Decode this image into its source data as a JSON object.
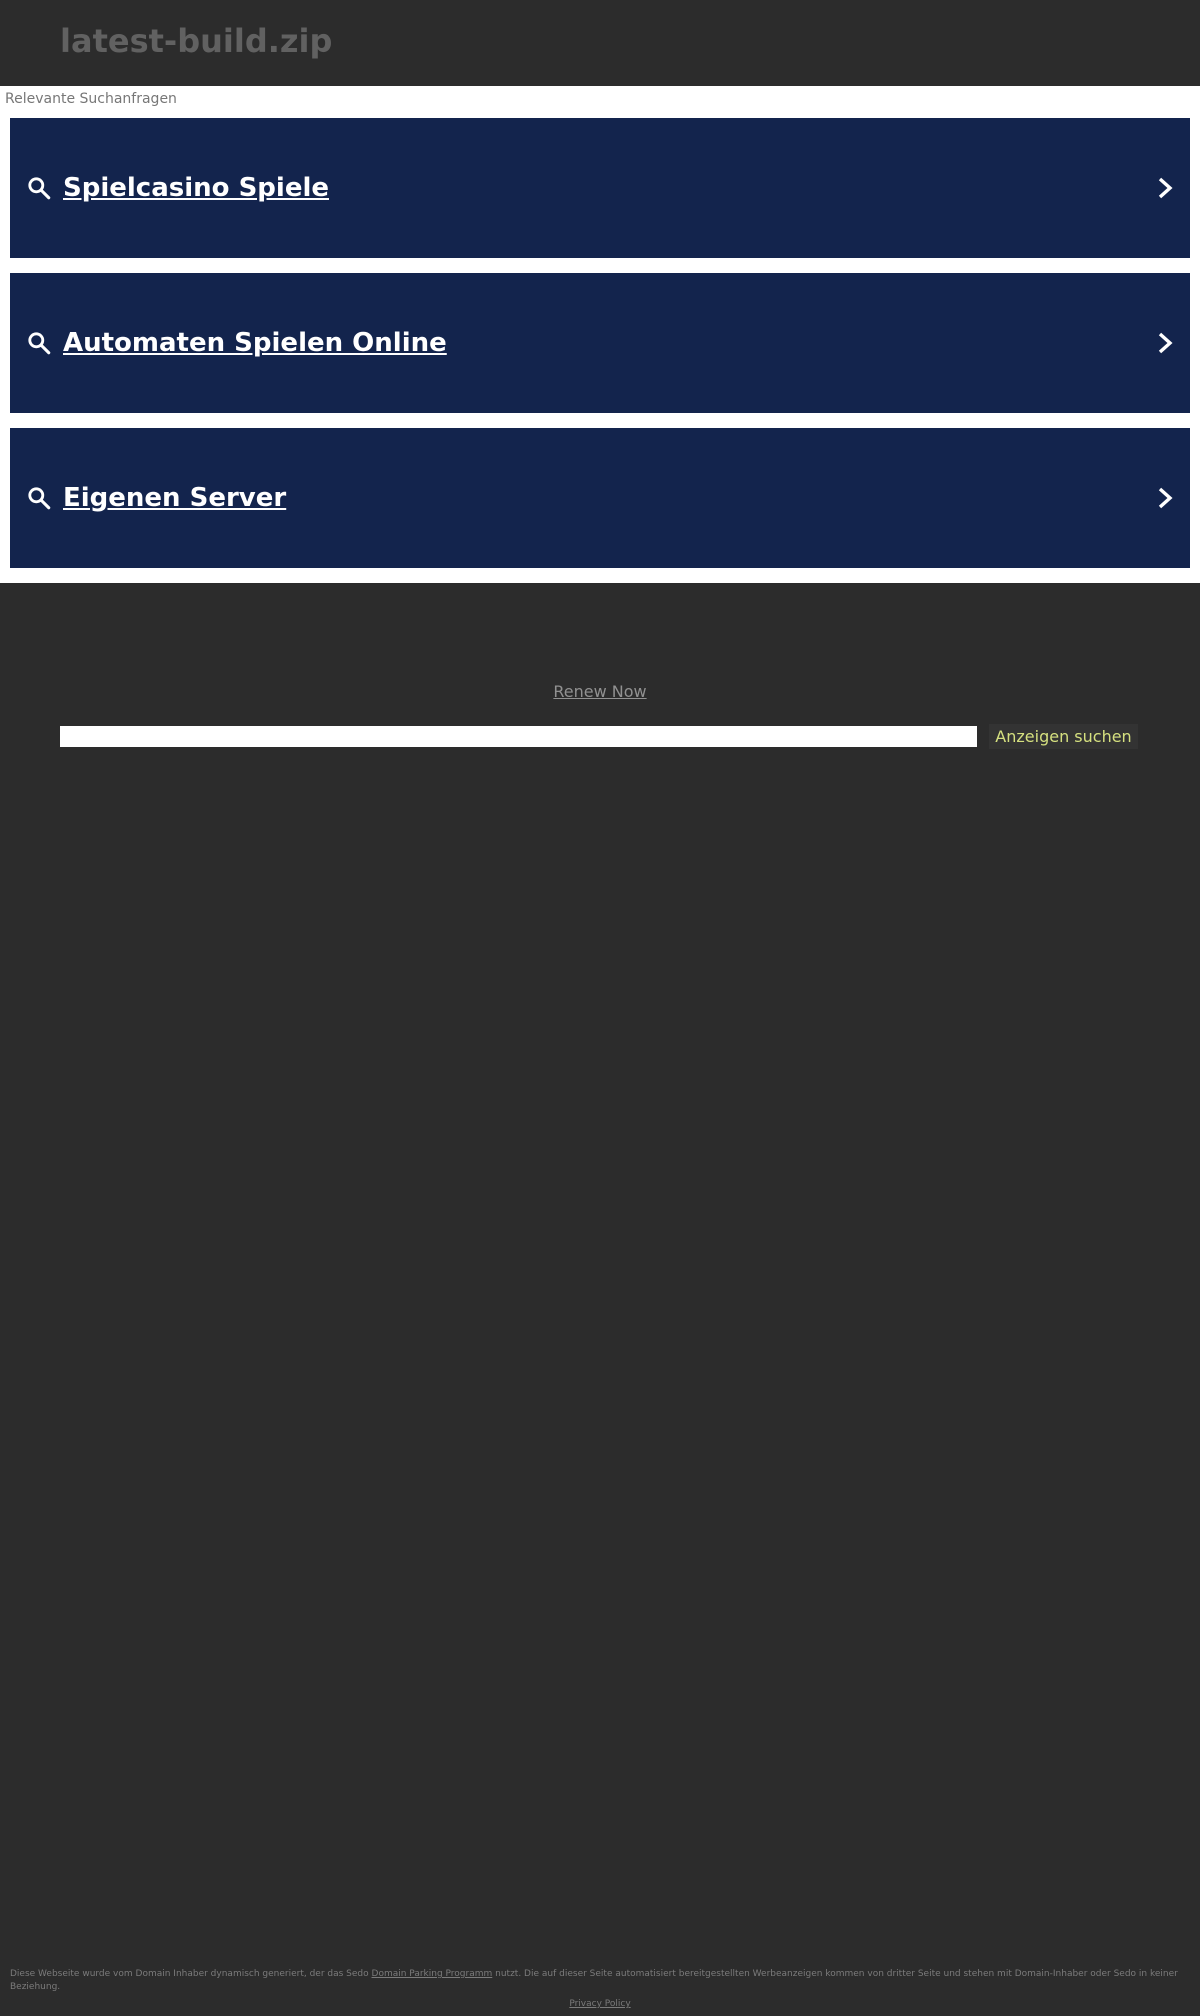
{
  "header": {
    "domain": "latest-build.zip"
  },
  "related_searches": {
    "heading": "Relevante Suchanfragen",
    "items": [
      {
        "label": "Spielcasino Spiele"
      },
      {
        "label": "Automaten Spielen Online"
      },
      {
        "label": "Eigenen Server"
      }
    ]
  },
  "renew": {
    "label": "Renew Now"
  },
  "search": {
    "value": "",
    "button_label": "Anzeigen suchen"
  },
  "footer": {
    "text_before": "Diese Webseite wurde vom Domain Inhaber dynamisch generiert, der das Sedo ",
    "link_label": "Domain Parking Programm",
    "text_after": " nutzt. Die auf dieser Seite automatisiert bereitgestellten Werbeanzeigen kommen von dritter Seite und stehen mit Domain-Inhaber oder Sedo in keiner Beziehung.",
    "privacy_label": "Privacy Policy"
  },
  "colors": {
    "page_background": "#2c2c2c",
    "result_background": "#13244d",
    "result_text": "#ffffff",
    "button_text": "#d5e07f",
    "title_text": "#616161"
  },
  "icons": {
    "result_icon": "search-icon",
    "result_arrow": "chevron-right-icon"
  }
}
